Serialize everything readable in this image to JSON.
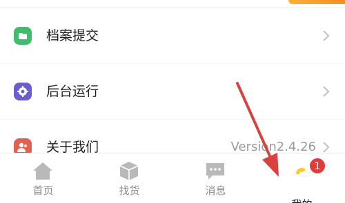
{
  "menu": {
    "items": [
      {
        "label": "档案提交",
        "icon": "folder-icon",
        "color": "#3fbd6a"
      },
      {
        "label": "后台运行",
        "icon": "gear-icon",
        "color": "#6a5ecf"
      },
      {
        "label": "关于我们",
        "icon": "people-icon",
        "color": "#e1614e",
        "value": "Version2.4.26"
      }
    ]
  },
  "tabbar": {
    "tabs": [
      {
        "label": "首页",
        "icon": "home-icon"
      },
      {
        "label": "找货",
        "icon": "box-icon"
      },
      {
        "label": "消息",
        "icon": "message-icon"
      },
      {
        "label": "我的",
        "icon": "profile-icon",
        "badge": "1"
      }
    ]
  },
  "colors": {
    "accent": "#ff8c1a",
    "badge": "#e23b3b",
    "annotation_arrow": "#d9413f"
  }
}
